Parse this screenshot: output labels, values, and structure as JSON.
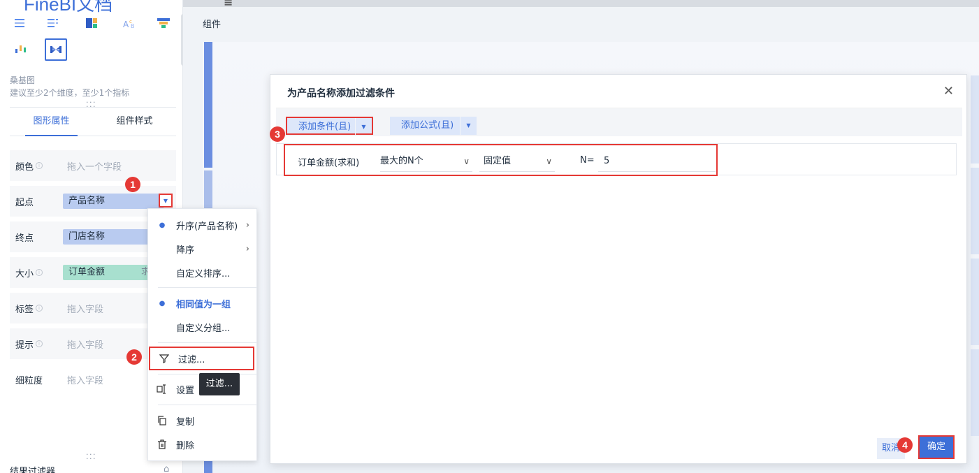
{
  "brand": "FineBI文档",
  "left_panel": {
    "chart_name": "桑基图",
    "chart_hint": "建议至少2个维度，至少1个指标",
    "tabs": [
      "图形属性",
      "组件样式"
    ],
    "rows": {
      "color": {
        "label": "颜色",
        "placeholder": "拖入一个字段"
      },
      "source": {
        "label": "起点",
        "chip": "产品名称"
      },
      "target": {
        "label": "终点",
        "chip": "门店名称"
      },
      "size": {
        "label": "大小",
        "chip": "订单金额",
        "agg": "求和"
      },
      "tag": {
        "label": "标签",
        "placeholder": "拖入字段"
      },
      "tooltip": {
        "label": "提示",
        "placeholder": "拖入字段"
      },
      "granularity": {
        "label": "细粒度",
        "placeholder": "拖入字段"
      }
    },
    "result_filter": "结果过滤器"
  },
  "menu": {
    "items": {
      "asc": "升序(产品名称)",
      "desc": "降序",
      "custom_sort": "自定义排序...",
      "same_group": "相同值为一组",
      "custom_group": "自定义分组...",
      "filter": "过滤...",
      "settings": "设置",
      "copy": "复制",
      "delete": "删除"
    },
    "tooltip": "过滤..."
  },
  "canvas": {
    "component_title": "组件"
  },
  "modal": {
    "title": "为产品名称添加过滤条件",
    "add_condition": "添加条件(且)",
    "add_formula": "添加公式(且)",
    "condition": {
      "field": "订单金额(求和)",
      "operator": "最大的N个",
      "value_type": "固定值",
      "n_label": "N=",
      "n_value": "5"
    },
    "cancel": "取消",
    "ok": "确定"
  },
  "badges": [
    "1",
    "2",
    "3",
    "4"
  ],
  "colors": {
    "accent": "#3d6fd8",
    "annotation": "#e53935"
  }
}
